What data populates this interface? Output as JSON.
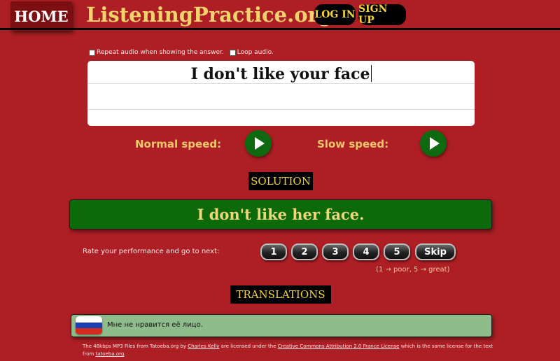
{
  "header": {
    "home_label": "HOME",
    "site_title": "ListeningPractice.org",
    "login_label": "LOG IN",
    "signup_label": "SIGN UP"
  },
  "options": {
    "repeat_label": "Repeat audio when showing the answer.",
    "loop_label": "Loop audio."
  },
  "answer": {
    "value": "I don't like your face"
  },
  "speeds": {
    "normal_label": "Normal speed:",
    "slow_label": "Slow speed:"
  },
  "solution": {
    "heading": "SOLUTION",
    "text": "I don't like her face."
  },
  "rating": {
    "label": "Rate your performance and go to next:",
    "buttons": [
      "1",
      "2",
      "3",
      "4",
      "5",
      "Skip"
    ],
    "hint": "(1 → poor, 5 → great)"
  },
  "translations": {
    "heading": "TRANSLATIONS",
    "items": [
      {
        "text": "Мне не нравится её лицо.",
        "flag_icon": "russia-flag-icon"
      }
    ]
  },
  "footer": {
    "part1": "The 48kbps MP3 Files from Tatoeba.org by ",
    "link1": "Charles Kelly",
    "part2": " are licensed under the ",
    "link2": "Creative Commons Attribution 2.0 France License",
    "part3": " which is the same license for the text from ",
    "link3": "tatoeba.org",
    "part4": "."
  },
  "colors": {
    "background": "#ad1f24",
    "title_gold": "#f3d16d",
    "button_green": "#0d6a10",
    "translation_green": "#8fbc8b"
  }
}
